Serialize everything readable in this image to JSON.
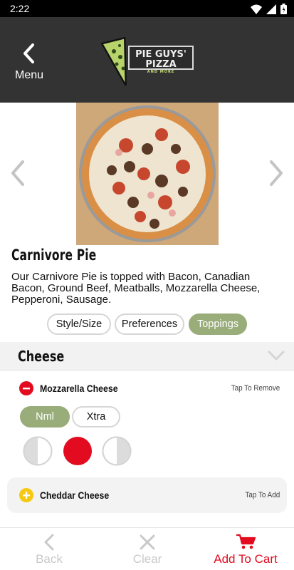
{
  "status_bar": {
    "time": "2:22"
  },
  "header": {
    "menu_label": "Menu",
    "logo_text": "PIE GUYS' PIZZA",
    "logo_subtext": "AND MORE"
  },
  "item": {
    "name": "Carnivore Pie",
    "description": "Our Carnivore Pie is topped with Bacon, Canadian Bacon, Ground Beef, Meatballs, Mozzarella Cheese, Pepperoni, Sausage."
  },
  "tabs": [
    {
      "label": "Style/Size",
      "active": false
    },
    {
      "label": "Preferences",
      "active": false
    },
    {
      "label": "Toppings",
      "active": true
    }
  ],
  "section": {
    "title": "Cheese"
  },
  "toppings": [
    {
      "name": "Mozzarella Cheese",
      "action": "Tap To Remove",
      "selected": true,
      "amount_options": [
        "Nml",
        "Xtra"
      ],
      "selected_amount": "Nml",
      "coverage_options": [
        "left-half",
        "whole",
        "right-half"
      ],
      "selected_coverage": "whole"
    },
    {
      "name": "Cheddar Cheese",
      "action": "Tap To Add",
      "selected": false
    }
  ],
  "bottom_bar": {
    "back_label": "Back",
    "clear_label": "Clear",
    "cart_label": "Add To Cart"
  },
  "colors": {
    "header_bg": "#333333",
    "accent_green": "#98ad79",
    "accent_red": "#e30b1f",
    "accent_yellow": "#f7c811"
  }
}
